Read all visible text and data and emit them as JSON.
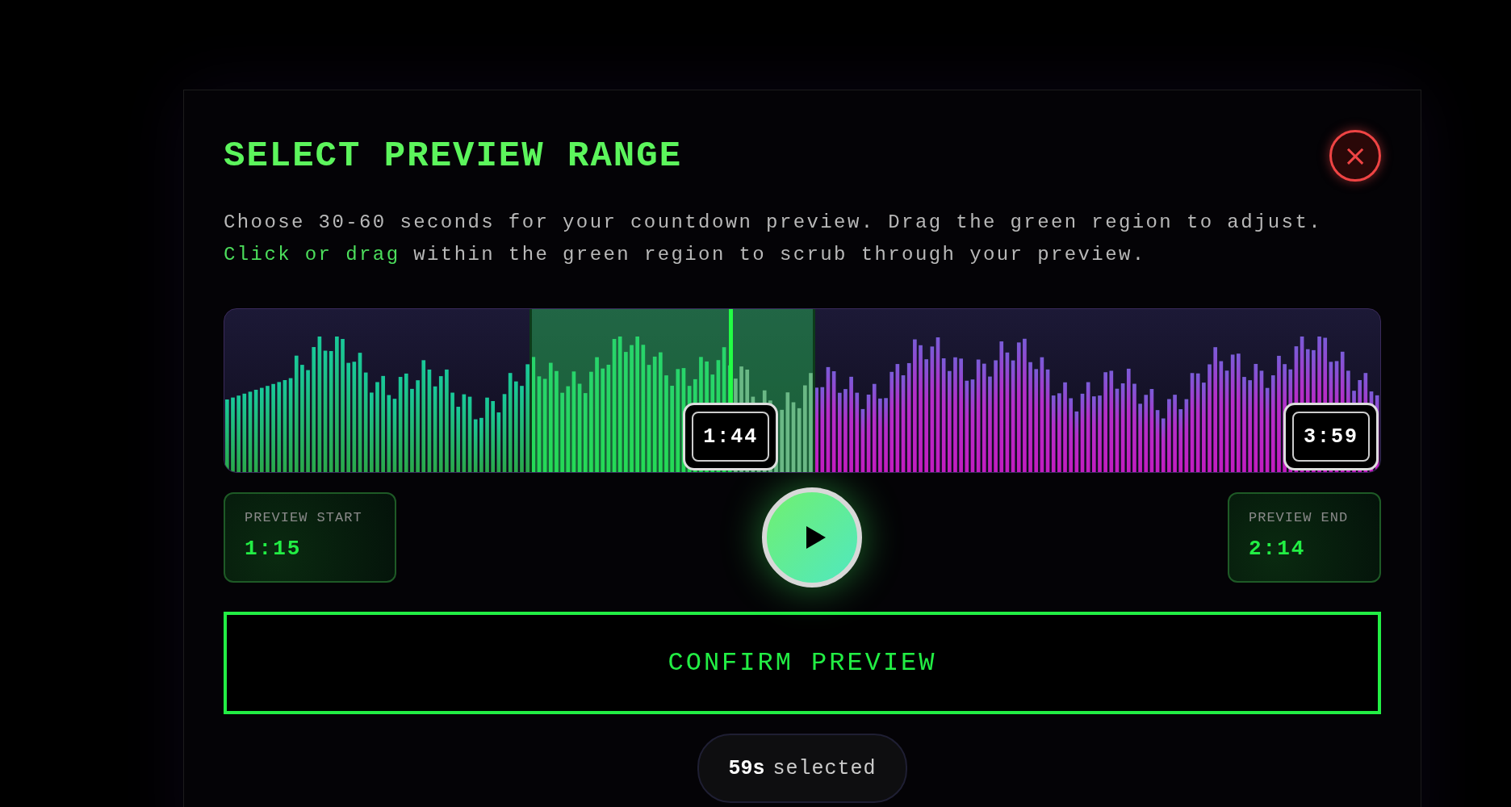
{
  "dialog": {
    "title": "SELECT PREVIEW RANGE",
    "close_label": "×",
    "description": [
      "Choose 30-60 seconds for your countdown preview. Drag the green region to adjust.",
      "**Click or drag** within the green region to scrub through your preview."
    ]
  },
  "waveform": {
    "selection_start": {
      "level": 0.265
    },
    "selection_end": {
      "level": 0.51
    },
    "playhead": {
      "level": 0.438,
      "time": "1:44"
    },
    "total_time": "3:59"
  },
  "preview_start": {
    "label": "PREVIEW START",
    "time": "1:15"
  },
  "preview_end": {
    "label": "PREVIEW END",
    "time": "2:14"
  },
  "play_button": {
    "playing": false
  },
  "confirm_button": "CONFIRM PREVIEW",
  "selected_summary": {
    "amount": "59s",
    "label": "selected"
  }
}
